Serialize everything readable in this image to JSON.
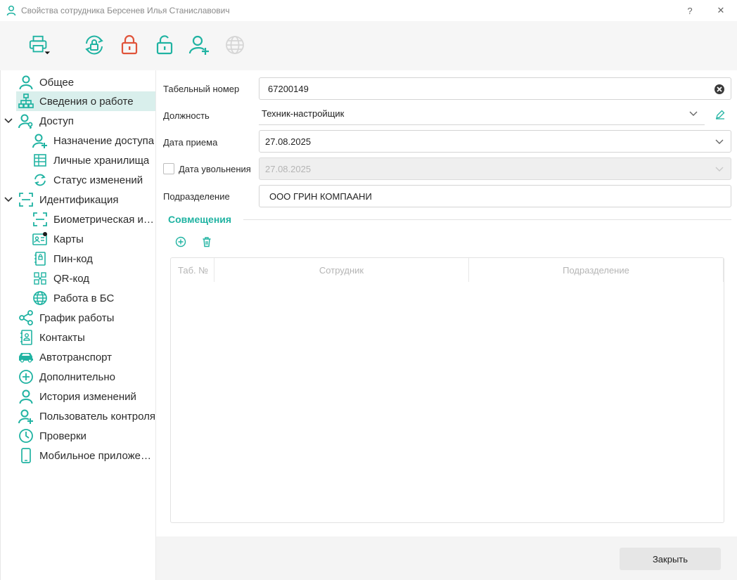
{
  "window": {
    "title": "Свойства сотрудника Берсенев Илья Станиславович",
    "help_label": "?",
    "close_label": "✕"
  },
  "colors": {
    "accent": "#20b3a2",
    "danger": "#e0533a",
    "active_bg": "#d9efec"
  },
  "toolbar": {
    "buttons": [
      {
        "name": "print-icon"
      },
      {
        "name": "sync-lock-icon"
      },
      {
        "name": "lock-icon"
      },
      {
        "name": "unlock-icon"
      },
      {
        "name": "user-add-icon"
      },
      {
        "name": "globe-icon"
      }
    ]
  },
  "sidebar": {
    "items": [
      {
        "label": "Общее",
        "icon": "user-icon"
      },
      {
        "label": "Сведения о работе",
        "icon": "org-structure-icon"
      },
      {
        "label": "Доступ",
        "icon": "user-key-icon"
      },
      {
        "label": "Назначение доступа",
        "icon": "user-add-icon"
      },
      {
        "label": "Личные хранилища",
        "icon": "grid-storage-icon"
      },
      {
        "label": "Статус изменений",
        "icon": "refresh-icon"
      },
      {
        "label": "Идентификация",
        "icon": "scan-frame-icon"
      },
      {
        "label": "Биометрическая идентификация",
        "icon": "scan-frame-icon"
      },
      {
        "label": "Карты",
        "icon": "id-card-icon"
      },
      {
        "label": "Пин-код",
        "icon": "pin-icon"
      },
      {
        "label": "QR-код",
        "icon": "qr-icon"
      },
      {
        "label": "Работа в БС",
        "icon": "globe-icon"
      },
      {
        "label": "График работы",
        "icon": "share-icon"
      },
      {
        "label": "Контакты",
        "icon": "contacts-icon"
      },
      {
        "label": "Автотранспорт",
        "icon": "car-icon"
      },
      {
        "label": "Дополнительно",
        "icon": "plus-circle-icon"
      },
      {
        "label": "История изменений",
        "icon": "user-icon"
      },
      {
        "label": "Пользователь контроля",
        "icon": "user-plus-icon"
      },
      {
        "label": "Проверки",
        "icon": "clock-icon"
      },
      {
        "label": "Мобильное приложение",
        "icon": "phone-icon"
      }
    ]
  },
  "form": {
    "tab_number_label": "Табельный номер",
    "tab_number_value": "67200149",
    "position_label": "Должность",
    "position_value": "Техник-настройщик",
    "hire_date_label": "Дата приема",
    "hire_date_value": "27.08.2025",
    "dismissal_label": "Дата увольнения",
    "dismissal_value": "27.08.2025",
    "dismissal_checked": false,
    "department_label": "Подразделение",
    "department_value": "ООО ГРИН КОМПААНИ"
  },
  "combinations": {
    "title": "Совмещения",
    "columns": [
      "Таб. №",
      "Сотрудник",
      "Подразделение"
    ],
    "rows": []
  },
  "footer": {
    "close_label": "Закрыть"
  }
}
